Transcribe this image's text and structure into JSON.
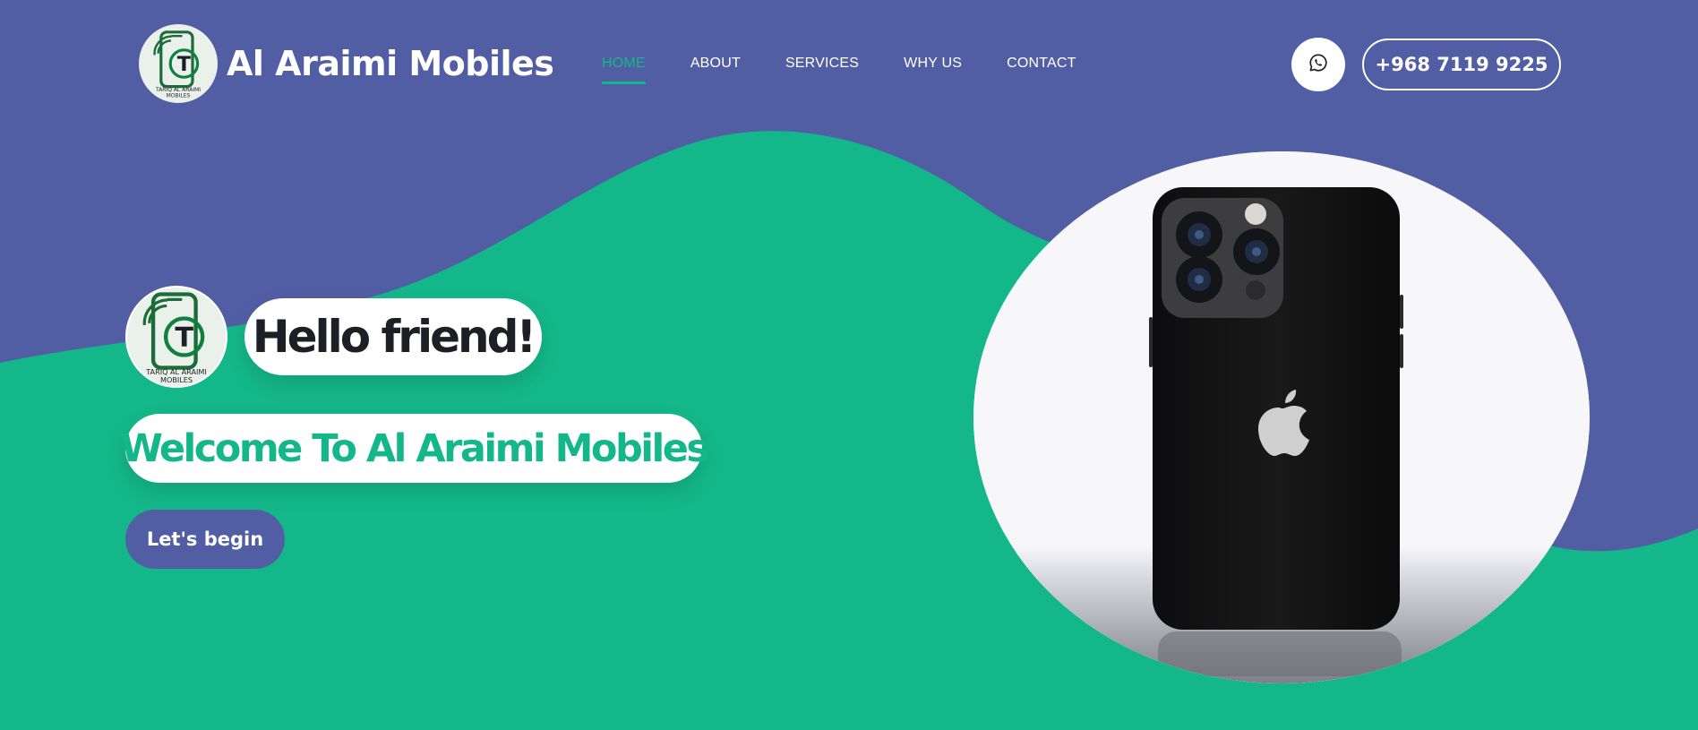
{
  "brand": {
    "name": "Al Araimi Mobiles",
    "logo_caption_line1": "TARIQ AL ARAIMI",
    "logo_caption_line2": "MOBILES",
    "logo_icon": "phone-signal-t-logo"
  },
  "nav": {
    "items": [
      {
        "label": "HOME",
        "active": true
      },
      {
        "label": "ABOUT",
        "active": false
      },
      {
        "label": "SERVICES",
        "active": false
      },
      {
        "label": "WHY US",
        "active": false
      },
      {
        "label": "CONTACT",
        "active": false
      }
    ]
  },
  "contact": {
    "whatsapp_icon": "whatsapp-icon",
    "phone": "+968 7119 9225"
  },
  "hero": {
    "greeting": "Hello friend!",
    "welcome": "Welcome To Al Araimi Mobiles",
    "cta_label": "Let's begin",
    "image": "black-smartphone-rear-view"
  },
  "colors": {
    "primary_purple": "#525ea4",
    "accent_green": "#14b789",
    "white": "#ffffff",
    "dark_text": "#1e1f26"
  }
}
